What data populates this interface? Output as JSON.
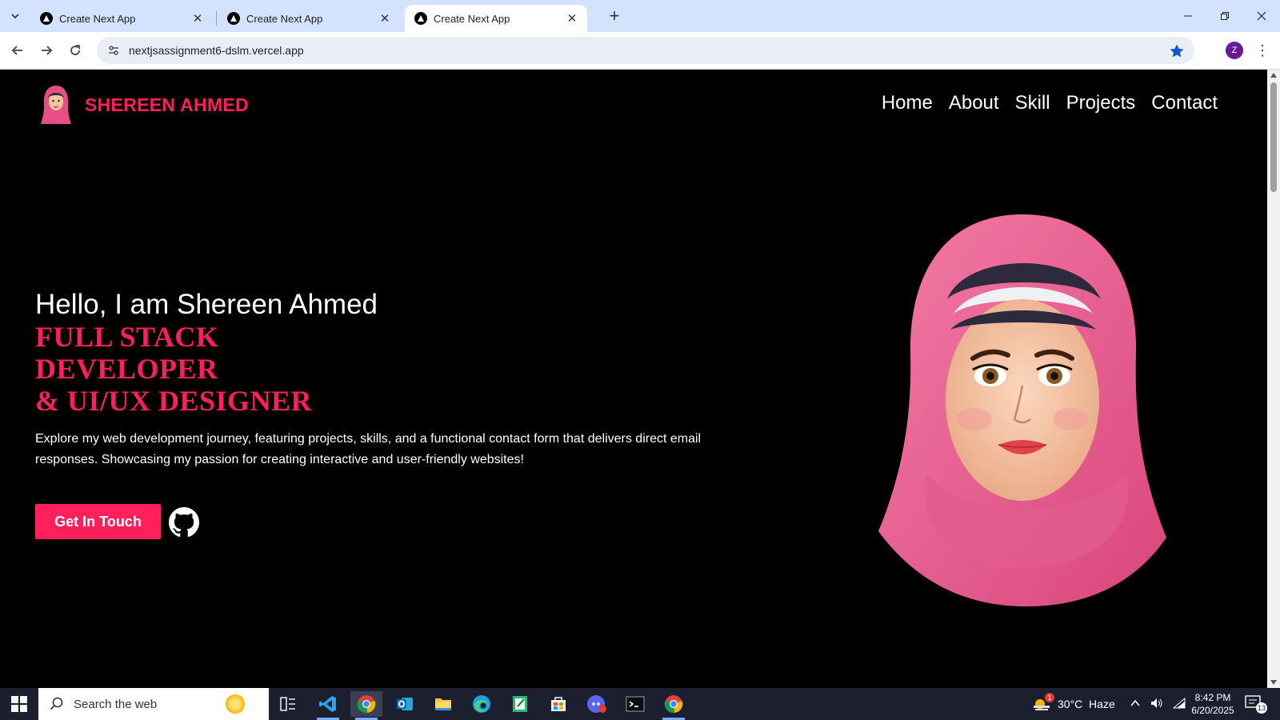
{
  "browser": {
    "tabs": [
      {
        "title": "Create Next App",
        "active": false
      },
      {
        "title": "Create Next App",
        "active": false
      },
      {
        "title": "Create Next App",
        "active": true
      }
    ],
    "url": "nextjsassignment6-dslm.vercel.app",
    "profile_initial": "Z"
  },
  "site": {
    "brand_name": "SHEREEN AHMED",
    "nav": [
      "Home",
      "About",
      "Skill",
      "Projects",
      "Contact"
    ],
    "hero": {
      "greeting": "Hello, I am Shereen Ahmed",
      "title_lines": [
        "FULL STACK",
        "DEVELOPER",
        "& UI/UX DESIGNER"
      ],
      "description": "Explore my web development journey, featuring projects, skills, and a functional contact form that delivers direct email responses. Showcasing my passion for creating interactive and user-friendly websites!",
      "cta_label": "Get In Touch"
    },
    "accent_color": "#ff1f5a"
  },
  "taskbar": {
    "search_placeholder": "Search the web",
    "weather": "30°C  Haze",
    "weather_badge": "1",
    "time": "8:42 PM",
    "date": "6/20/2025",
    "notifications": "13",
    "pinned_icons": [
      "task-view-icon",
      "vscode-icon",
      "chrome-icon",
      "outlook-icon",
      "file-explorer-icon",
      "edge-icon",
      "notepad-icon",
      "store-icon",
      "discord-icon",
      "terminal-icon",
      "chrome-profile-icon"
    ]
  }
}
